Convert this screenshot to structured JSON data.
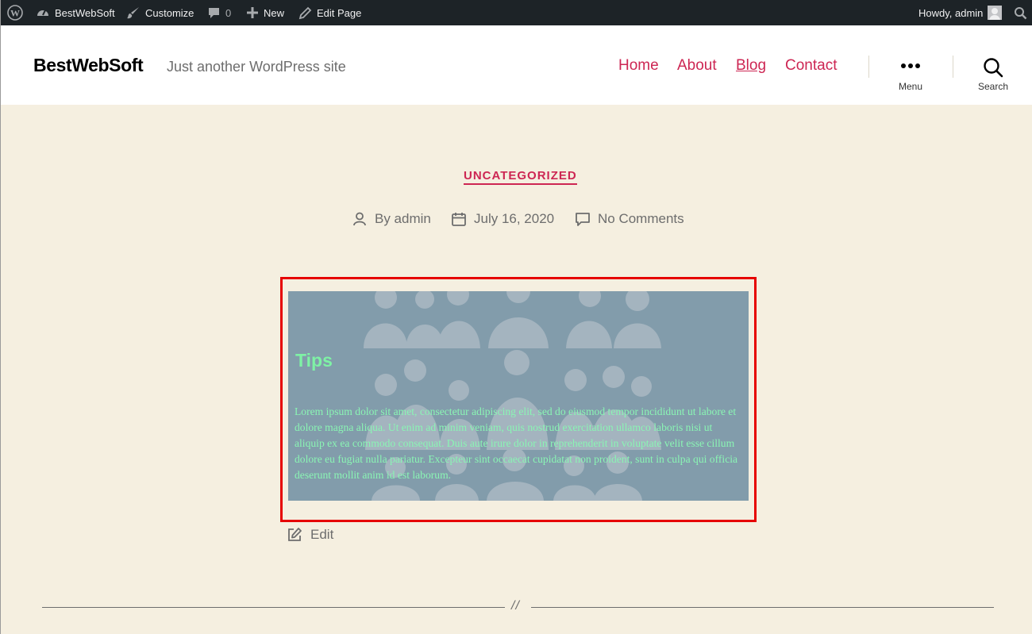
{
  "admin_bar": {
    "site_name": "BestWebSoft",
    "customize": "Customize",
    "comments_count": "0",
    "new": "New",
    "edit_page": "Edit Page",
    "howdy": "Howdy, admin"
  },
  "header": {
    "site_title": "BestWebSoft",
    "tagline": "Just another WordPress site",
    "nav": [
      "Home",
      "About",
      "Blog",
      "Contact"
    ],
    "current_nav": "Blog",
    "menu_label": "Menu",
    "search_label": "Search"
  },
  "post": {
    "category": "UNCATEGORIZED",
    "author": "By admin",
    "date": "July 16, 2020",
    "comments": "No Comments",
    "edit": "Edit"
  },
  "banner": {
    "title": "Tips",
    "text": "Lorem ipsum dolor sit amet, consectetur adipiscing elit, sed do eiusmod tempor incididunt ut labore et dolore magna aliqua. Ut enim ad minim veniam, quis nostrud exercitation ullamco laboris nisi ut aliquip ex ea commodo consequat. Duis aute irure dolor in reprehenderit in voluptate velit esse cillum dolore eu fugiat nulla pariatur. Excepteur sint occaecat cupidatat non proident, sunt in culpa qui officia deserunt mollit anim id est laborum.",
    "background_color": "#829cab",
    "text_color": "#7ef2a5",
    "highlight_border_color": "#e60000"
  },
  "separator": "//",
  "colors": {
    "accent": "#cd2653",
    "page_background": "#f5efe0",
    "admin_bar": "#1d2327"
  }
}
